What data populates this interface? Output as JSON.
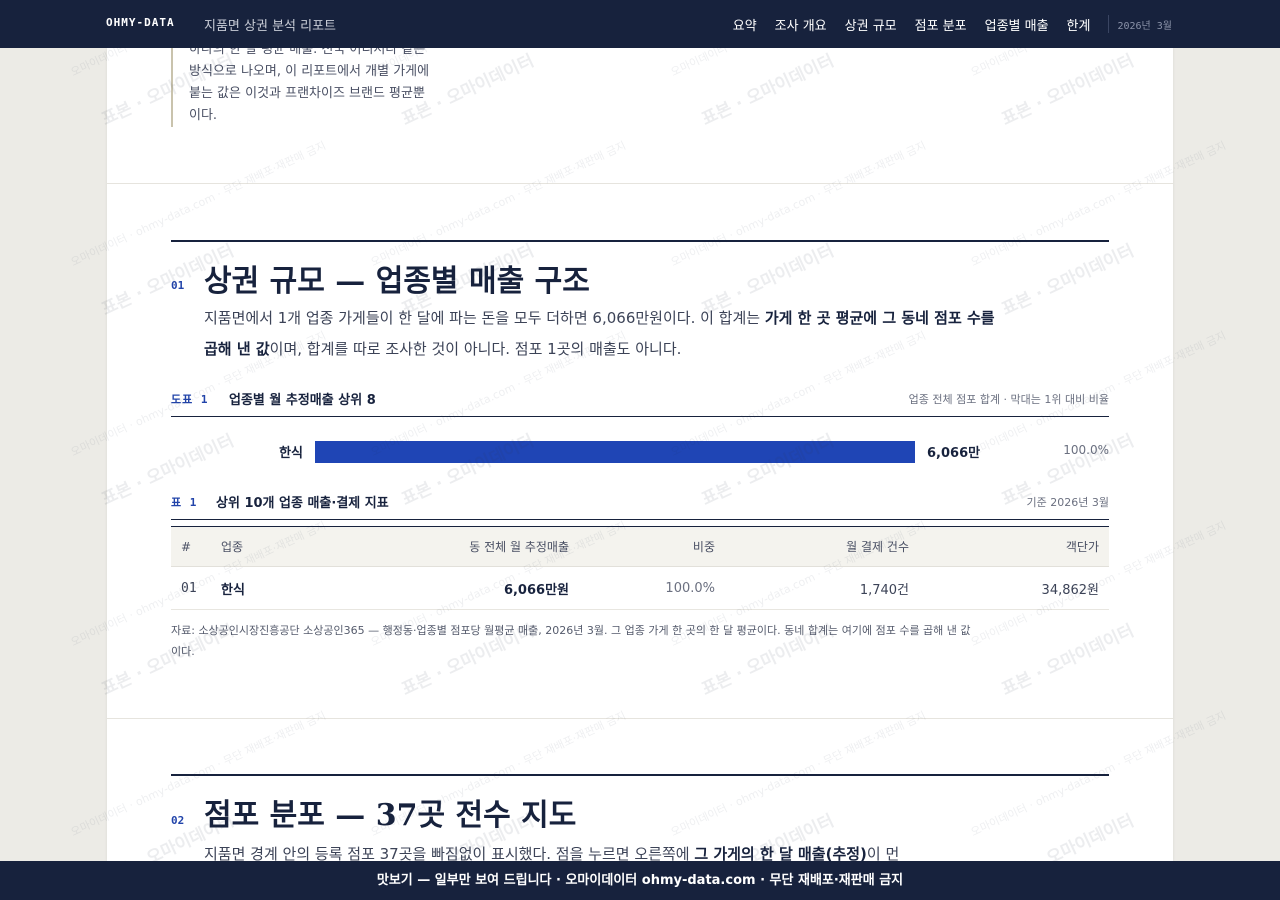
{
  "header": {
    "brand": "OHMY-DATA",
    "report_title": "지품면 상권 분석 리포트",
    "nav": [
      "요약",
      "조사 개요",
      "상권 규모",
      "점포 분포",
      "업종별 매출",
      "한계"
    ],
    "date": "2026년 3월"
  },
  "intro_quote": {
    "lines": [
      "하나의 한 달 평균 매출. 전국 어디서나 같은",
      "방식으로 나오며, 이 리포트에서 개별 가게에",
      "붙는 값은 이것과 프랜차이즈 브랜드 평균뿐",
      "이다."
    ]
  },
  "section1": {
    "num": "01",
    "title": "상권 규모 — 업종별 매출 구조",
    "body_pre": "지품면에서 1개 업종 가게들이 한 달에 파는 돈을 모두 더하면 6,066만원이다. 이 합계는 ",
    "body_bold": "가게 한 곳 평균에 그 동네 점포 수를 곱해 낸 값",
    "body_post": "이며, 합계를 따로 조사한 것이 아니다. 점포 1곳의 매출도 아니다.",
    "figure": {
      "label": "도표 1",
      "title": "업종별 월 추정매출 상위 8",
      "note": "업종 전체 점포 합계 · 막대는 1위 대비 비율"
    },
    "table": {
      "label": "표 1",
      "title": "상위 10개 업종 매출·결제 지표",
      "note": "기준 2026년 3월",
      "headers": [
        "#",
        "업종",
        "동 전체 월 추정매출",
        "비중",
        "월 결제 건수",
        "객단가"
      ],
      "rows": [
        {
          "rank": "01",
          "name": "한식",
          "sales": "6,066만원",
          "share": "100.0%",
          "count": "1,740건",
          "avg": "34,862원"
        }
      ]
    },
    "source_line1": "자료: 소상공인시장진흥공단 소상공인365 — 행정동·업종별 점포당 월평균 매출, 2026년 3월. 그 업종 가게 한 곳의 한 달 평균이다. 동네 합계는 여기에 점포 수를 곱해 낸 값",
    "source_line2": "이다."
  },
  "chart_data": {
    "type": "bar",
    "title": "업종별 월 추정매출 상위 8",
    "categories": [
      "한식"
    ],
    "values": [
      6066
    ],
    "value_labels": [
      "6,066만"
    ],
    "pct_labels": [
      "100.0%"
    ],
    "unit": "만원",
    "orientation": "horizontal"
  },
  "section2": {
    "num": "02",
    "title": "점포 분포 — 37곳 전수 지도",
    "body_pre": "지품면 경계 안의 등록 점포 37곳을 빠짐없이 표시했다. 점을 누르면 오른쪽에 ",
    "body_bold": "그 가게의 한 달 매출(추정)",
    "body_post": "이 먼"
  },
  "watermark": {
    "main": "표본 · 오마이데이터",
    "sub": "오마이데이터 · ohmy-data.com · 무단 재배포·재판매 금지"
  },
  "footer": {
    "text": "맛보기 — 일부만 보여 드립니다 · 오마이데이터 ohmy-data.com · 무단 재배포·재판매 금지"
  },
  "colors": {
    "navy": "#17223d",
    "accent": "#1f45b5",
    "paper": "#ffffff",
    "background": "#ecebe6"
  }
}
